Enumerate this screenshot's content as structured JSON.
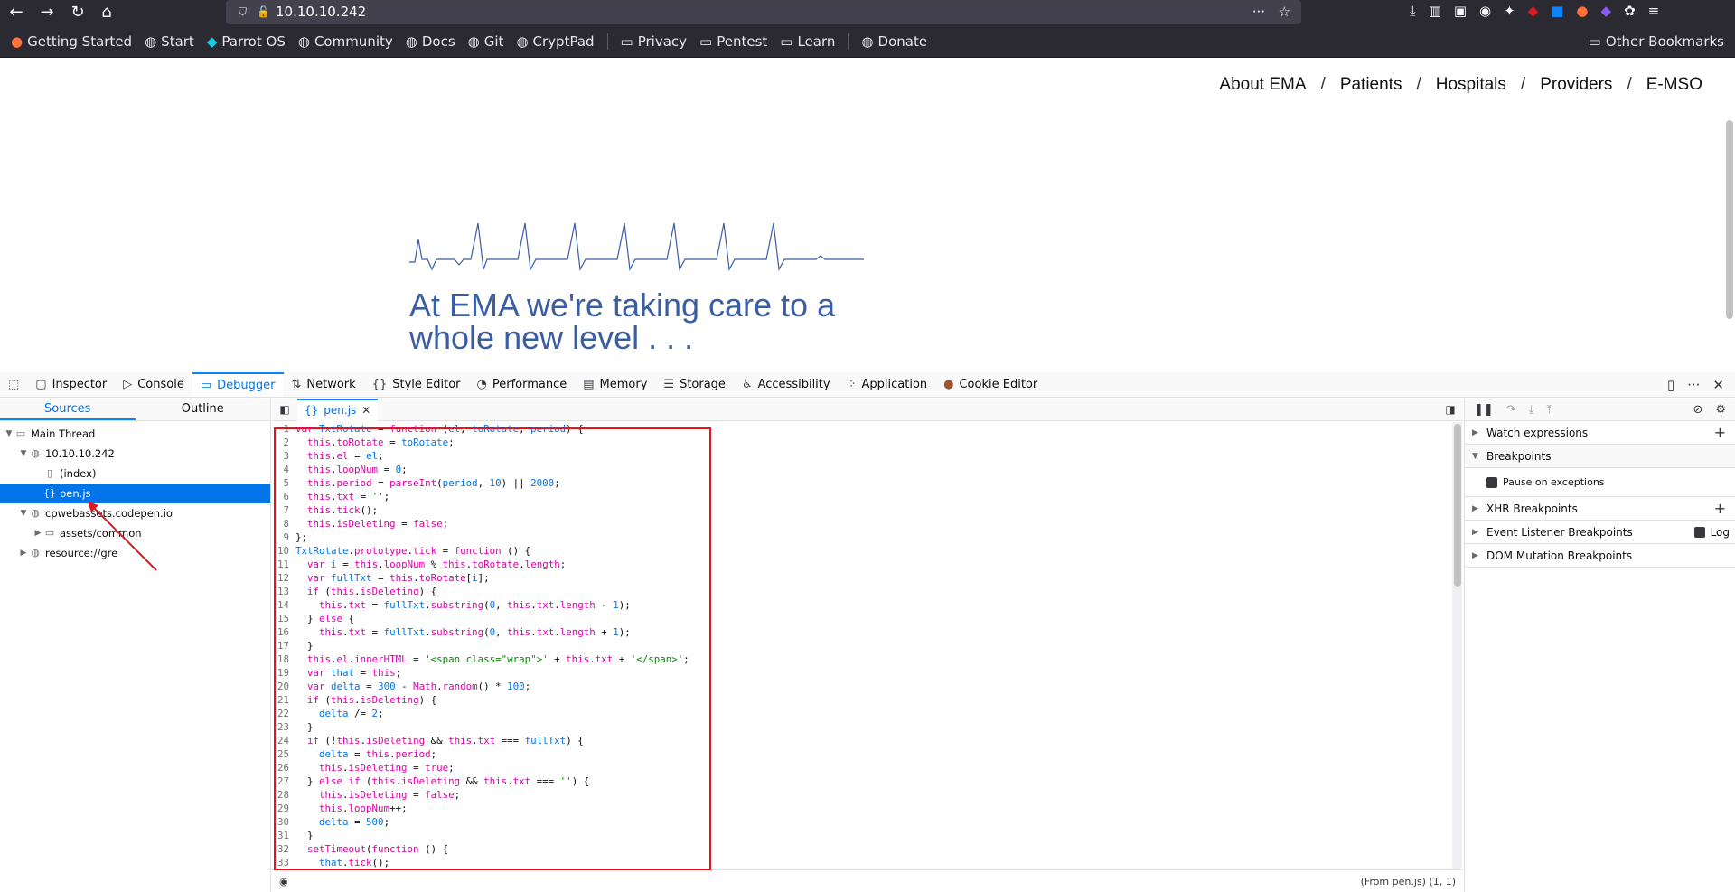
{
  "browser": {
    "url": "10.10.10.242",
    "bookmarks": [
      "Getting Started",
      "Start",
      "Parrot OS",
      "Community",
      "Docs",
      "Git",
      "CryptPad",
      "Privacy",
      "Pentest",
      "Learn",
      "Donate"
    ],
    "other_bookmarks": "Other Bookmarks"
  },
  "page": {
    "nav": [
      "About EMA",
      "/",
      "Patients",
      "/",
      "Hospitals",
      "/",
      "Providers",
      "/",
      "E-MSO"
    ],
    "hero_text": "At EMA we're taking care to a whole new level . . ."
  },
  "devtools": {
    "tabs": [
      {
        "label": "Inspector",
        "icon": "inspector-icon"
      },
      {
        "label": "Console",
        "icon": "console-icon"
      },
      {
        "label": "Debugger",
        "icon": "debugger-icon",
        "active": true
      },
      {
        "label": "Network",
        "icon": "network-icon"
      },
      {
        "label": "Style Editor",
        "icon": "style-editor-icon"
      },
      {
        "label": "Performance",
        "icon": "performance-icon"
      },
      {
        "label": "Memory",
        "icon": "memory-icon"
      },
      {
        "label": "Storage",
        "icon": "storage-icon"
      },
      {
        "label": "Accessibility",
        "icon": "accessibility-icon"
      },
      {
        "label": "Application",
        "icon": "application-icon"
      },
      {
        "label": "Cookie Editor",
        "icon": "cookie-icon"
      }
    ],
    "sources_tab": "Sources",
    "outline_tab": "Outline",
    "tree": {
      "main_thread": "Main Thread",
      "host": "10.10.10.242",
      "index": "(index)",
      "file": "pen.js",
      "codepen": "cpwebassets.codepen.io",
      "assets": "assets/common",
      "resource": "resource://gre"
    },
    "editor_tab": "pen.js",
    "footer_pos": "(From pen.js)  (1, 1)",
    "right_panel": {
      "watch": "Watch expressions",
      "breakpoints": "Breakpoints",
      "pause_exceptions": "Pause on exceptions",
      "xhr": "XHR Breakpoints",
      "event_listener": "Event Listener Breakpoints",
      "log": "Log",
      "dom_mutation": "DOM Mutation Breakpoints"
    }
  }
}
